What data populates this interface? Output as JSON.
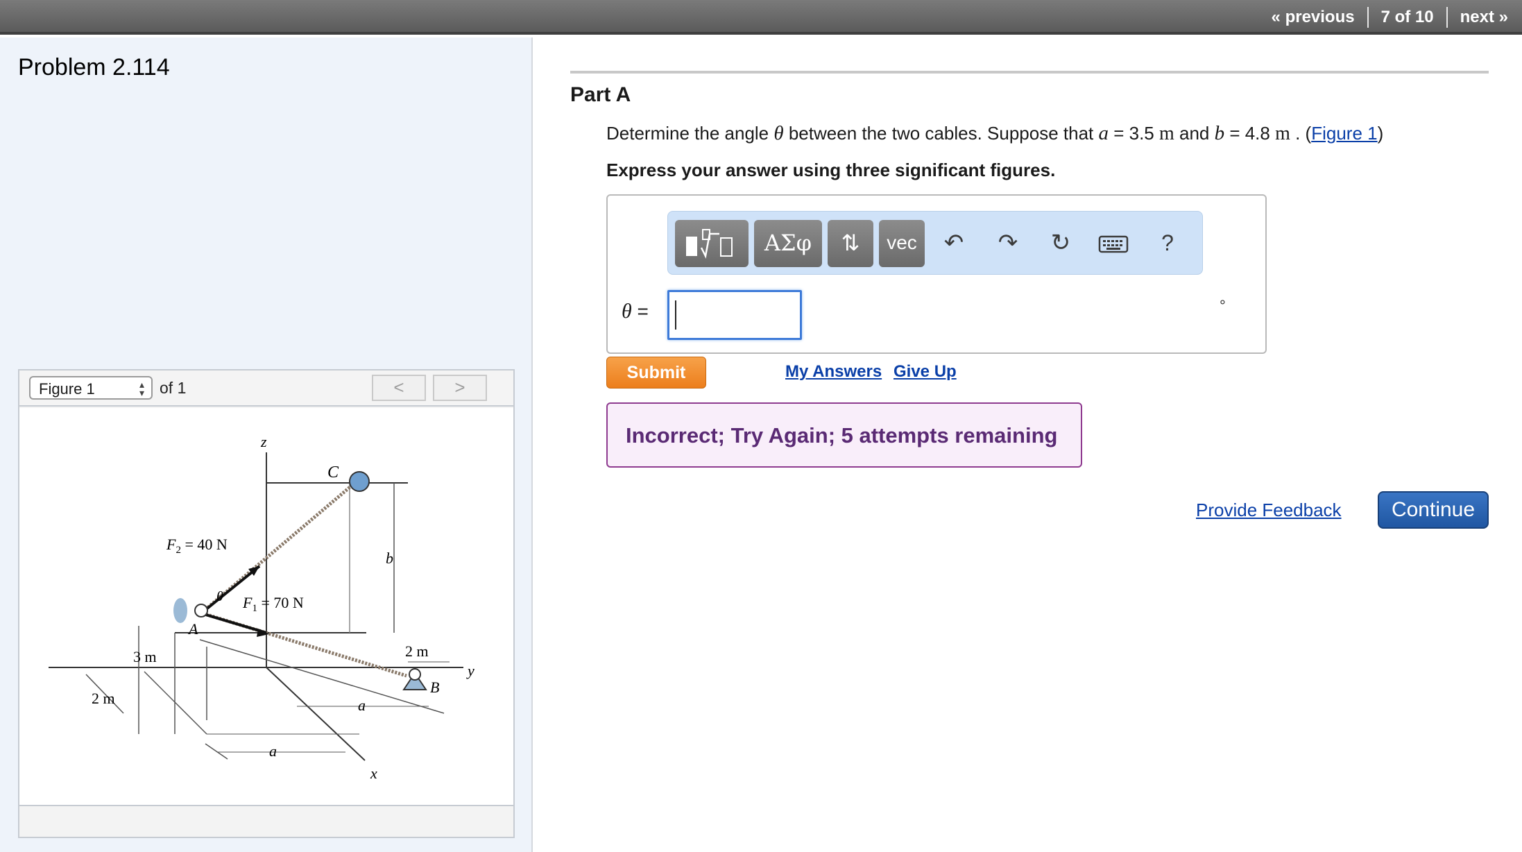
{
  "topnav": {
    "previous": "« previous",
    "position": "7 of 10",
    "next": "next »"
  },
  "left": {
    "problem_title": "Problem 2.114",
    "figure_select": "Figure 1",
    "figure_count": "of 1",
    "prev_arrow": "<",
    "next_arrow": ">",
    "figure": {
      "z": "z",
      "x": "x",
      "y": "y",
      "C": "C",
      "A": "A",
      "B": "B",
      "b": "b",
      "a1": "a",
      "a2": "a",
      "theta": "θ",
      "F2": "F",
      "F2_sub": "2",
      "F2_val": " = 40 N",
      "F1": "F",
      "F1_sub": "1",
      "F1_val": " = 70 N",
      "dim_3m": "3 m",
      "dim_2m_left": "2 m",
      "dim_2m_right": "2 m"
    }
  },
  "part": {
    "label": "Part A",
    "q1": "Determine the angle ",
    "q_theta": "θ",
    "q2": " between the two cables. Suppose that ",
    "q_a": "a",
    "q3": " = 3.5 ",
    "q_unit1": "m",
    "q4": " and ",
    "q_b": "b",
    "q5": " = 4.8 ",
    "q_unit2": "m",
    "q6": " . (",
    "q_link": "Figure 1",
    "q7": ")",
    "instruction": "Express your answer using three significant figures."
  },
  "answer": {
    "toolbar": {
      "greek": "ΑΣφ",
      "arrows": "⇅",
      "vec": "vec",
      "help": "?"
    },
    "label_theta": "θ",
    "label_eq": " =",
    "value": "",
    "degree": "°"
  },
  "actions": {
    "submit": "Submit",
    "my_answers": "My Answers",
    "give_up": "Give Up",
    "feedback": "Incorrect; Try Again; 5 attempts remaining",
    "provide_feedback": "Provide Feedback",
    "continue": "Continue"
  },
  "colors": {
    "submit": "#ec7e1c",
    "continue": "#1f56a2",
    "feedback_border": "#8e3a8f",
    "link": "#0a3fa8"
  }
}
